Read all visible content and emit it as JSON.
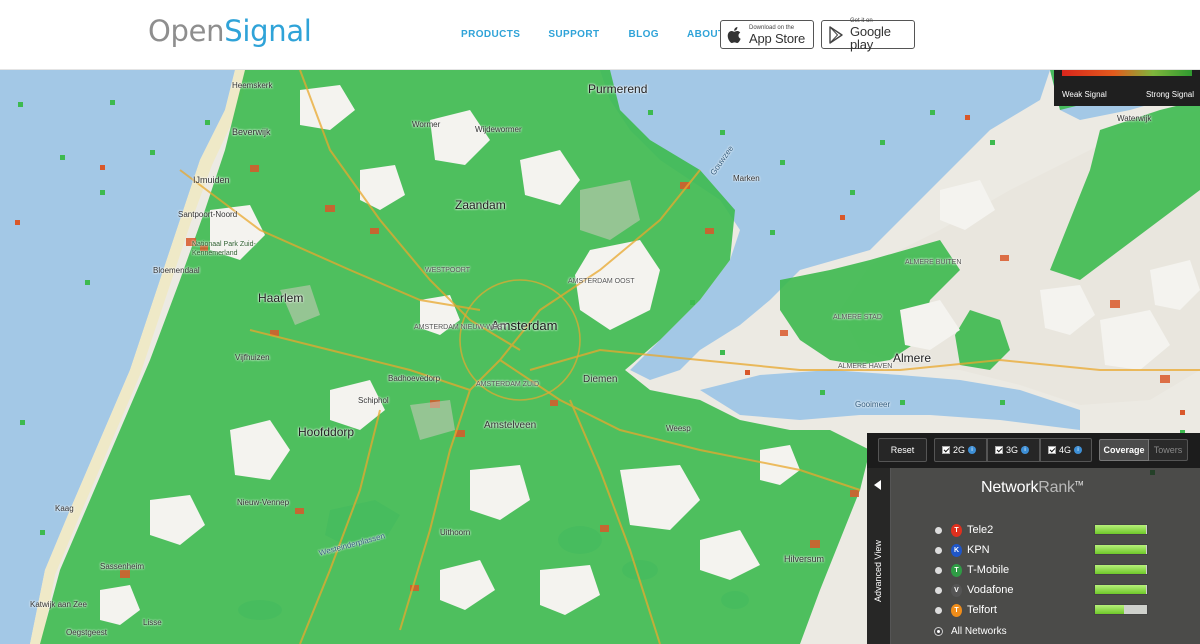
{
  "header": {
    "logo_open": "Open",
    "logo_signal": "Signal",
    "nav": [
      "PRODUCTS",
      "SUPPORT",
      "BLOG",
      "ABOUT"
    ],
    "app_store": {
      "small": "Download on the",
      "big": "App Store",
      "icon": "apple-icon"
    },
    "google_play": {
      "small": "Get it on",
      "big": "Google play",
      "icon": "play-icon"
    }
  },
  "legend": {
    "weak": "Weak Signal",
    "strong": "Strong Signal"
  },
  "map": {
    "places": {
      "amsterdam": "Amsterdam",
      "haarlem": "Haarlem",
      "zaandam": "Zaandam",
      "almere": "Almere",
      "purmerend": "Purmerend",
      "hoofddorp": "Hoofddorp",
      "amstelveen": "Amstelveen",
      "diemen": "Diemen",
      "heemskerk": "Heemskerk",
      "beverwijk": "Beverwijk",
      "ijmuiden": "IJmuiden",
      "santpoort": "Santpoort-Noord",
      "bloemendaal": "Bloemendaal",
      "nationaal_park": "Nationaal Park Zuid-Kennemerland",
      "uithoorn": "Uithoorn",
      "hilversum": "Hilversum",
      "weesp": "Weesp",
      "schiphol": "Schiphol",
      "badhoevedorp": "Badhoevedorp",
      "sassenheim": "Sassenheim",
      "katwijk": "Katwijk aan Zee",
      "oegstgeest": "Oegstgeest",
      "nieuw_vennep": "Nieuw-Vennep",
      "wormer": "Wormer",
      "wijdewormer": "Wijdewormer",
      "marken": "Marken",
      "almere_stad": "ALMERE STAD",
      "almere_haven": "ALMERE HAVEN",
      "almere_buiten": "ALMERE BUITEN",
      "gooimeer": "Gooimeer",
      "gouwzee": "Gouwzee",
      "waterwijk": "Waterwijk",
      "westeinderplassen": "Westeinderplassen",
      "kaag": "Kaag",
      "amsterdam_zuid": "AMSTERDAM ZUID",
      "amsterdam_oost": "AMSTERDAM OOST",
      "amsterdam_nw": "AMSTERDAM NIEUW-WEST",
      "westpoort": "WESTPOORT",
      "lisse": "Lisse",
      "vijfhuizen": "Vijfhuizen"
    },
    "signal_colors": {
      "strong": "#3dba4f",
      "weak": "#d9582a",
      "medium": "#b98a4a"
    }
  },
  "panel": {
    "reset": "Reset",
    "networks": [
      {
        "label": "2G"
      },
      {
        "label": "3G"
      },
      {
        "label": "4G"
      }
    ],
    "info_glyph": "i",
    "mode": {
      "coverage": "Coverage",
      "towers": "Towers"
    },
    "advanced_view": "Advanced View",
    "rank_title_a": "Network",
    "rank_title_b": "Rank",
    "rank_tm": "TM",
    "operators": [
      {
        "name": "Tele2",
        "color": "#e0301e",
        "glyph": "T",
        "rank": 0.98
      },
      {
        "name": "KPN",
        "color": "#1f56c8",
        "glyph": "K",
        "rank": 0.98
      },
      {
        "name": "T-Mobile",
        "color": "#2f9c45",
        "glyph": "T",
        "rank": 0.98
      },
      {
        "name": "Vodafone",
        "color": "#555555",
        "glyph": "V",
        "rank": 0.98
      },
      {
        "name": "Telfort",
        "color": "#f08d1a",
        "glyph": "T",
        "rank": 0.55
      }
    ],
    "all_networks": "All Networks"
  }
}
